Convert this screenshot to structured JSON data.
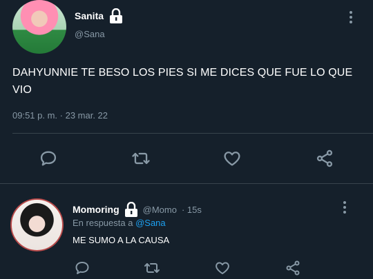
{
  "main_tweet": {
    "display_name": "Sanita",
    "handle": "@Sana",
    "text": "DAHYUNNIE TE BESO LOS PIES SI ME DICES QUE FUE LO QUE VIO",
    "timestamp": "09:51 p. m. · 23 mar. 22",
    "verified_icon": "lock-icon"
  },
  "reply": {
    "display_name": "Momoring",
    "handle": "@Momo",
    "time": "· 15s",
    "reply_prefix": "En respuesta a",
    "reply_to": "@Sana",
    "text": "ME SUMO A LA CAUSA"
  },
  "actions": [
    "comment-icon",
    "retweet-icon",
    "like-icon",
    "share-icon"
  ],
  "colors": {
    "background": "#15202b",
    "muted": "#8899a6",
    "divider": "#38444d",
    "link": "#1da1f2"
  }
}
